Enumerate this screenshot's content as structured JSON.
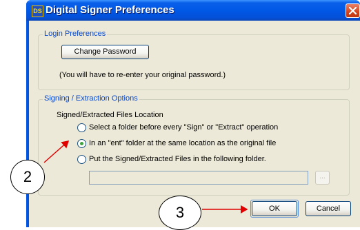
{
  "window": {
    "title": "Digital Signer Preferences",
    "app_icon": "app-icon"
  },
  "login": {
    "legend": "Login Preferences",
    "change_password_label": "Change Password",
    "note": "(You will have to re-enter your original password.)"
  },
  "signing": {
    "legend": "Signing / Extraction Options",
    "location_label": "Signed/Extracted Files Location",
    "options": [
      {
        "label": "Select a folder before every \"Sign\" or \"Extract\" operation",
        "selected": false
      },
      {
        "label": "In an \"ent\" folder at the same location as the original file",
        "selected": true
      },
      {
        "label": "Put the Signed/Extracted Files in the following folder.",
        "selected": false
      }
    ],
    "folder_path": "",
    "browse_label": "..."
  },
  "footer": {
    "ok_label": "OK",
    "cancel_label": "Cancel"
  },
  "annotations": {
    "callout_2": "2",
    "callout_3": "3",
    "arrow_color": "#e00000"
  }
}
